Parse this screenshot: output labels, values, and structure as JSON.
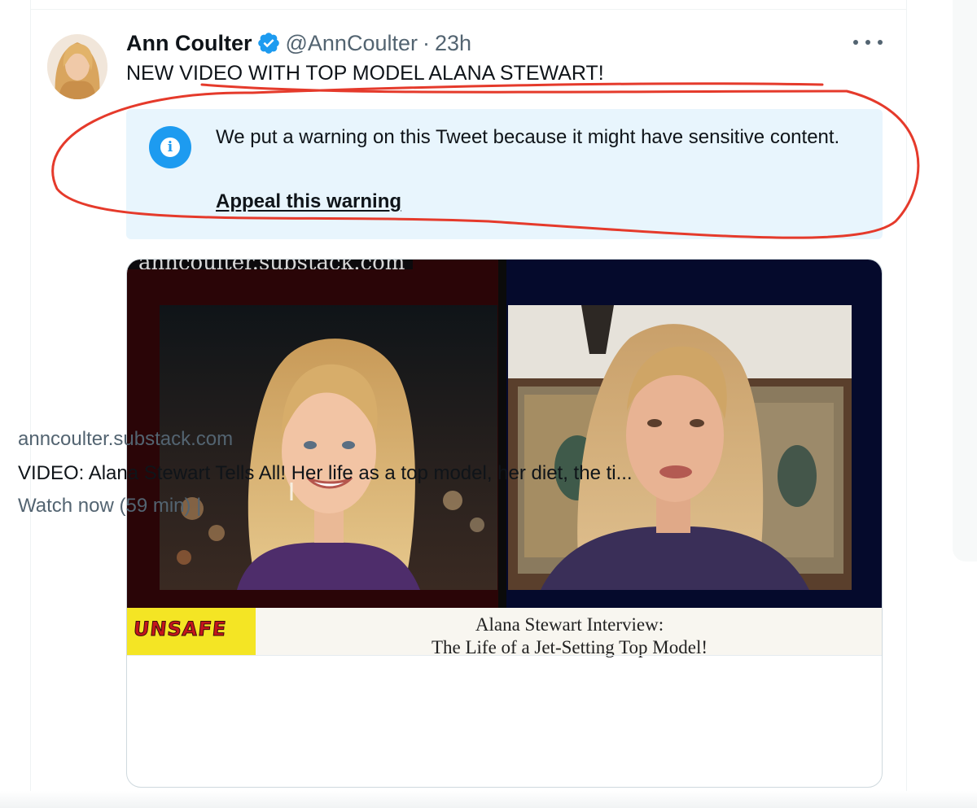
{
  "colors": {
    "accent": "#1d9bf0",
    "text_primary": "#0f1419",
    "text_secondary": "#536471",
    "warning_bg": "#e8f5fd",
    "annotation": "#e53a2b"
  },
  "tweet": {
    "display_name": "Ann Coulter",
    "verified": true,
    "handle": "@AnnCoulter",
    "separator": "·",
    "time": "23h",
    "text": "NEW VIDEO WITH TOP MODEL ALANA STEWART!"
  },
  "warning": {
    "icon": "info-icon",
    "message": "We put a warning on this Tweet because it might have sensitive content.",
    "link_label": "Appeal this warning"
  },
  "card": {
    "watermark": "anncoulter.substack.com",
    "logo_text": "UNSAFE",
    "banner_line1": "Alana Stewart Interview:",
    "banner_line2": "The Life of a Jet-Setting Top Model!",
    "domain": "anncoulter.substack.com",
    "title": "VIDEO: Alana Stewart Tells All! Her life as a top model, her diet, the ti...",
    "subtitle": "Watch now (59 min) |"
  },
  "icons": {
    "verified": "verified-badge-icon",
    "more": "more-options-icon"
  }
}
